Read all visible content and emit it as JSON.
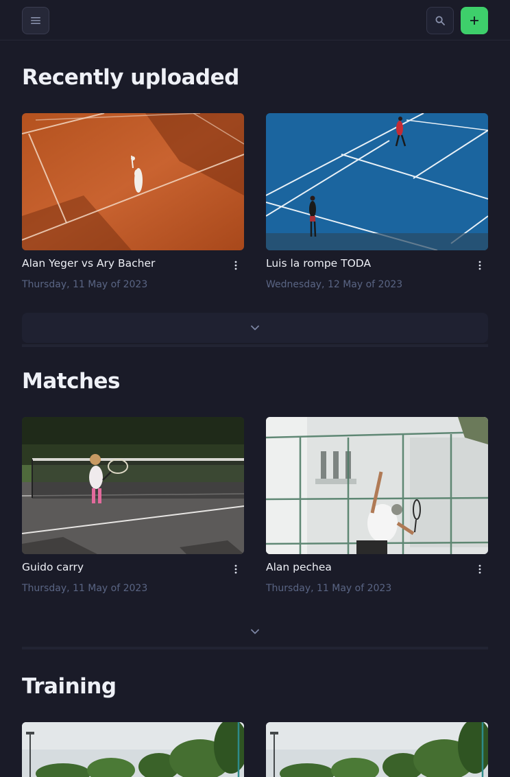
{
  "header": {
    "menu_icon": "hamburger-menu-icon",
    "search_icon": "search-icon",
    "add_icon": "plus-icon",
    "add_color": "#3ecf6b"
  },
  "sections": [
    {
      "title": "Recently uploaded",
      "items": [
        {
          "title": "Alan Yeger vs Ary Bacher",
          "date": "Thursday, 11 May of 2023",
          "thumb": "clay court tennis serve"
        },
        {
          "title": "Luis la rompe TODA",
          "date": "Wednesday, 12 May of 2023",
          "thumb": "blue hard court doubles"
        }
      ]
    },
    {
      "title": "Matches",
      "items": [
        {
          "title": "Guido carry",
          "date": "Thursday, 11 May of 2023",
          "thumb": "child with racket near net"
        },
        {
          "title": "Alan pechea",
          "date": "Thursday, 11 May of 2023",
          "thumb": "player serving by white building"
        }
      ]
    },
    {
      "title": "Training",
      "items": [
        {
          "thumb": "outdoor court with trees"
        },
        {
          "thumb": "outdoor court with trees"
        }
      ]
    }
  ],
  "colors": {
    "background": "#1a1b28",
    "date_text": "#5a6584",
    "surface": "#1f2131"
  }
}
